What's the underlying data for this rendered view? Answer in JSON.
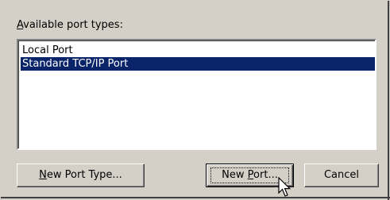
{
  "dialog": {
    "label_prefix": "",
    "label_accel": "A",
    "label_rest": "vailable port types:",
    "port_types": [
      {
        "label": "Local Port",
        "selected": false
      },
      {
        "label": "Standard TCP/IP Port",
        "selected": true
      }
    ],
    "buttons": {
      "new_port_type": {
        "accel": "N",
        "rest": "ew Port Type..."
      },
      "new_port": {
        "pre": "New ",
        "accel": "P",
        "rest": "ort..."
      },
      "cancel": {
        "label": "Cancel"
      }
    }
  },
  "colors": {
    "face": "#d4d0c8",
    "selection": "#0a246a",
    "list_bg": "#ffffff"
  },
  "cursor": {
    "icon": "mouse-pointer-icon"
  }
}
